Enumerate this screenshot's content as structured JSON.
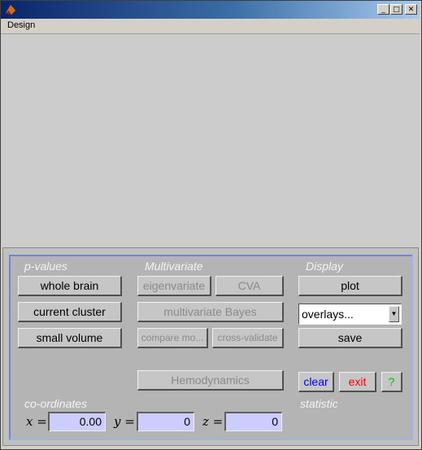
{
  "window": {
    "controls": {
      "minimize": "_",
      "maximize": "□",
      "close": "✕"
    },
    "menu": [
      "Design"
    ]
  },
  "sections": {
    "pvalues": "p-values",
    "multivariate": "Multivariate",
    "display": "Display",
    "coordinates": "co-ordinates",
    "statistic": "statistic"
  },
  "pvalues_buttons": {
    "whole_brain": "whole brain",
    "current_cluster": "current cluster",
    "small_volume": "small volume"
  },
  "multivariate_buttons": {
    "eigenvariate": "eigenvariate",
    "cva": "CVA",
    "multivariate_bayes": "multivariate Bayes",
    "compare_models": "compare mo...",
    "cross_validate": "cross-validate"
  },
  "display_buttons": {
    "plot": "plot",
    "overlays": "overlays...",
    "save": "save"
  },
  "hemodynamics": "Hemodynamics",
  "actions": {
    "clear": "clear",
    "exit": "exit",
    "help": "?"
  },
  "colors": {
    "clear": "#0000ff",
    "exit": "#ff0000",
    "help": "#00c000",
    "input_bg": "#ccccff",
    "panel_border": "#6f86d6"
  },
  "coordinates": {
    "x_label": "x =",
    "y_label": "y =",
    "z_label": "z =",
    "x": "0.00",
    "y": "0",
    "z": "0"
  }
}
